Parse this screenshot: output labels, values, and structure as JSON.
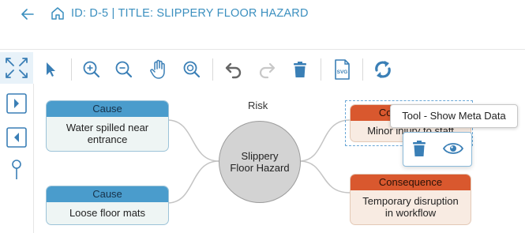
{
  "header": {
    "title": "ID: D-5 | TITLE: SLIPPERY FLOOR HAZARD"
  },
  "icons": {
    "back": "arrow-left-icon",
    "home": "home-icon",
    "fit": "fit-screen-icon",
    "pointer": "pointer-icon",
    "zoom_in": "zoom-in-icon",
    "zoom_out": "zoom-out-icon",
    "pan": "hand-icon",
    "zoom_fit": "zoom-fit-icon",
    "undo": "undo-icon",
    "redo": "redo-icon",
    "delete": "trash-icon",
    "export_svg": "svg-file-icon",
    "sync": "sync-icon",
    "view": "eye-icon"
  },
  "toolbar": {
    "svg_label": "SVG"
  },
  "diagram": {
    "risk_label": "Risk",
    "risk_node": "Slippery Floor Hazard",
    "causes": [
      {
        "header": "Cause",
        "text": "Water spilled near entrance"
      },
      {
        "header": "Cause",
        "text": "Loose floor mats"
      }
    ],
    "consequences": [
      {
        "header": "Consequence",
        "text": "Minor injury to staff"
      },
      {
        "header": "Consequence",
        "text": "Temporary disruption in workflow"
      }
    ]
  },
  "tooltip": {
    "text": "Tool - Show Meta Data"
  },
  "colors": {
    "accent": "#3b8fbf",
    "cause_header": "#4a9ccc",
    "consequence_header": "#d9582e",
    "risk_fill": "#d3d3d3",
    "icon_blue": "#3a7fb6"
  }
}
